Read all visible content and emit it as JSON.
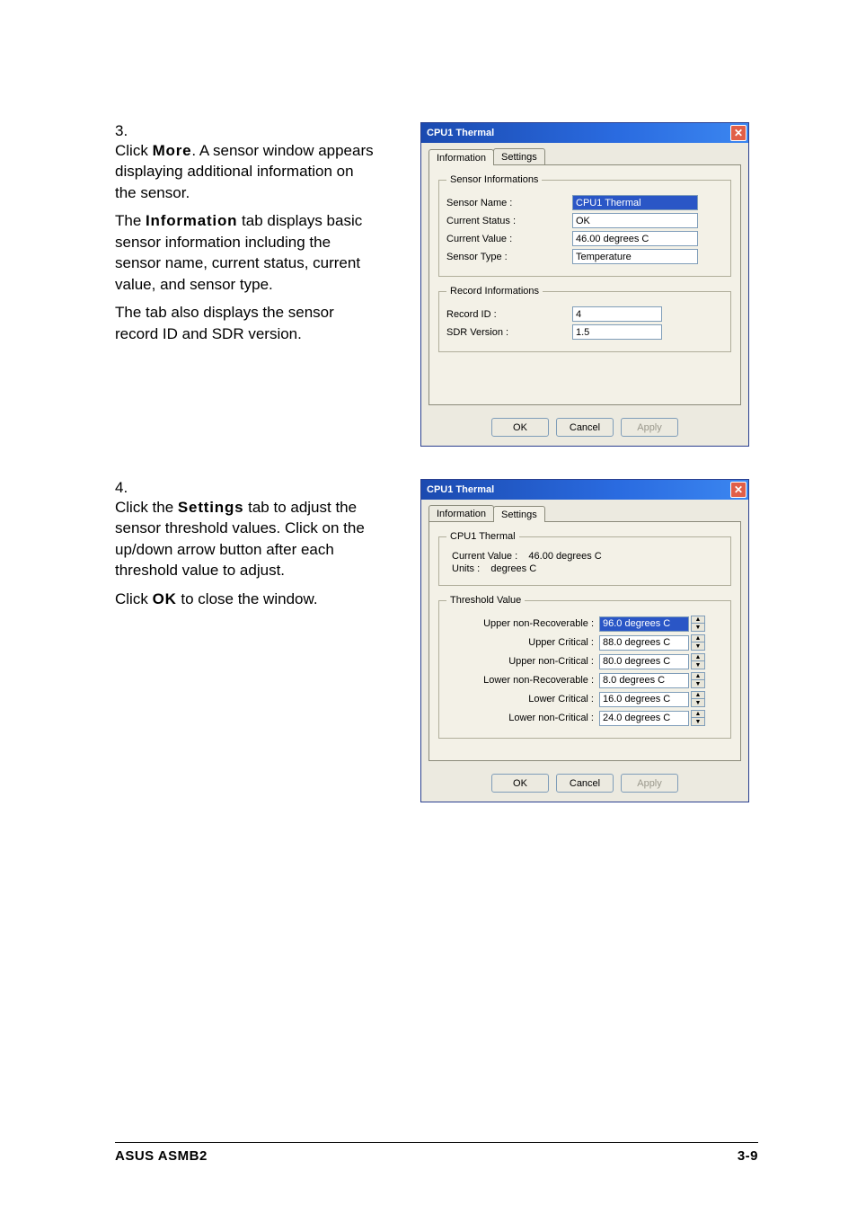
{
  "step3": {
    "num": "3.",
    "p1_pre": "Click ",
    "p1_bold": "More",
    "p1_post": ". A sensor window appears displaying additional information on the sensor.",
    "p2_pre": "The ",
    "p2_bold": "Information",
    "p2_post": " tab displays basic sensor information including the sensor name, current status, current value, and sensor type.",
    "p3": "The tab also displays the sensor record ID and SDR version."
  },
  "step4": {
    "num": "4.",
    "p1_pre": "Click the ",
    "p1_bold": "Settings",
    "p1_post": " tab to adjust the sensor threshold values. Click on the up/down arrow button after each threshold value to adjust.",
    "p2_pre": "Click ",
    "p2_bold": "OK",
    "p2_post": " to close the window."
  },
  "dlgInfo": {
    "title": "CPU1 Thermal",
    "tabs": {
      "info": "Information",
      "settings": "Settings"
    },
    "groups": {
      "sensor_legend": "Sensor Informations",
      "record_legend": "Record Informations"
    },
    "labels": {
      "sensor_name": "Sensor Name  :",
      "current_status": "Current Status :",
      "current_value": "Current Value  :",
      "sensor_type": "Sensor Type  :",
      "record_id": "Record ID      :",
      "sdr_version": "SDR Version :"
    },
    "values": {
      "sensor_name": "CPU1 Thermal",
      "current_status": "OK",
      "current_value": "46.00 degrees C",
      "sensor_type": "Temperature",
      "record_id": "4",
      "sdr_version": "1.5"
    },
    "buttons": {
      "ok": "OK",
      "cancel": "Cancel",
      "apply": "Apply"
    }
  },
  "dlgSet": {
    "title": "CPU1 Thermal",
    "tabs": {
      "info": "Information",
      "settings": "Settings"
    },
    "groups": {
      "top_legend": "CPU1 Thermal",
      "thresh_legend": "Threshold Value"
    },
    "top": {
      "cv_label": "Current Value :",
      "cv_value": "46.00 degrees C",
      "units_label": "Units              :",
      "units_value": "degrees C"
    },
    "thresh_labels": {
      "unr": "Upper non-Recoverable :",
      "uc": "Upper Critical :",
      "unc": "Upper non-Critical :",
      "lnr": "Lower non-Recoverable :",
      "lc": "Lower Critical :",
      "lnc": "Lower non-Critical :"
    },
    "thresh_values": {
      "unr": "96.0 degrees C",
      "uc": "88.0 degrees C",
      "unc": "80.0 degrees C",
      "lnr": "8.0 degrees C",
      "lc": "16.0 degrees C",
      "lnc": "24.0 degrees C"
    },
    "buttons": {
      "ok": "OK",
      "cancel": "Cancel",
      "apply": "Apply"
    }
  },
  "footer": {
    "left": "ASUS ASMB2",
    "right": "3-9"
  }
}
